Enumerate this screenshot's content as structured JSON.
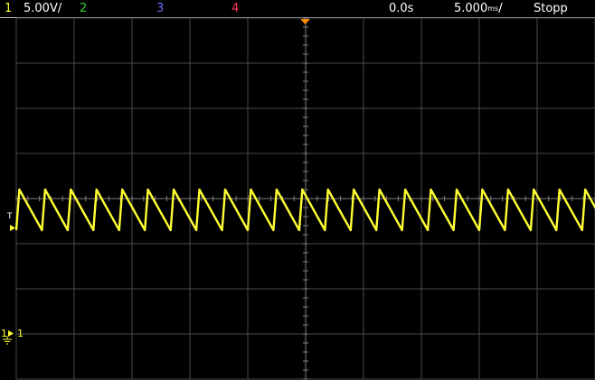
{
  "top_bar": {
    "ch1_num": "1",
    "ch1_scale": "5.00V/",
    "ch2_num": "2",
    "ch3_num": "3",
    "ch4_num": "4",
    "delay": "0.0s",
    "timebase": "5.000",
    "timebase_unit": "ms",
    "timebase_suffix": "/",
    "run_state": "Stopp"
  },
  "markers": {
    "trigger_label": "T",
    "ground_channel": "1",
    "ground_label": "1"
  },
  "colors": {
    "ch1": "#ffff33",
    "ch2": "#33cc33",
    "ch3": "#6b6bff",
    "ch4": "#ff3355",
    "grid": "#4a4a4a",
    "axis": "#808080",
    "trigger": "#ff8c00",
    "text": "#ffffff"
  },
  "chart_data": {
    "type": "line",
    "series": [
      {
        "name": "1",
        "color": "#ffff33",
        "waveform": "sawtooth",
        "cycles_on_screen": 22.5,
        "peak_divisions": 0.2,
        "trough_divisions": -0.7
      }
    ],
    "grid": {
      "horizontal_divisions": 10,
      "vertical_divisions": 8
    },
    "grid_on": true
  }
}
